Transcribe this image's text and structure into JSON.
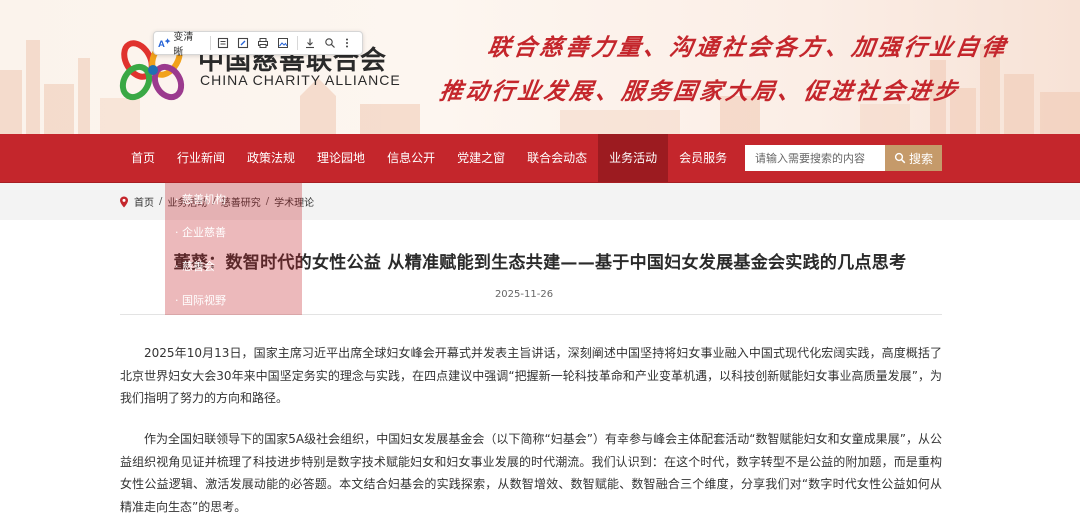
{
  "brand": {
    "name_cn": "中国慈善联合会",
    "name_en": "CHINA CHARITY ALLIANCE"
  },
  "slogan": {
    "line1": "联合慈善力量、沟通社会各方、加强行业自律",
    "line2": "推动行业发展、服务国家大局、促进社会进步"
  },
  "browser_toolbar": {
    "translate_label": "变清晰"
  },
  "nav": {
    "items": [
      {
        "label": "首页"
      },
      {
        "label": "行业新闻"
      },
      {
        "label": "政策法规"
      },
      {
        "label": "理论园地"
      },
      {
        "label": "信息公开"
      },
      {
        "label": "党建之窗"
      },
      {
        "label": "联合会动态"
      },
      {
        "label": "业务活动",
        "active": true
      },
      {
        "label": "会员服务"
      }
    ],
    "search_placeholder": "请输入需要搜索的内容",
    "search_button": "搜索"
  },
  "breadcrumb": [
    "首页",
    "业务活动",
    "慈善研究",
    "学术理论"
  ],
  "dropdown": {
    "items": [
      "慈善机构",
      "企业慈善",
      "慈善会",
      "国际视野"
    ]
  },
  "article": {
    "title": "董葵：数智时代的女性公益 从精准赋能到生态共建——基于中国妇女发展基金会实践的几点思考",
    "date": "2025-11-26",
    "paragraphs": [
      "2025年10月13日，国家主席习近平出席全球妇女峰会开幕式并发表主旨讲话，深刻阐述中国坚持将妇女事业融入中国式现代化宏阔实践，高度概括了北京世界妇女大会30年来中国坚定务实的理念与实践，在四点建议中强调“把握新一轮科技革命和产业变革机遇，以科技创新赋能妇女事业高质量发展”，为我们指明了努力的方向和路径。",
      "作为全国妇联领导下的国家5A级社会组织，中国妇女发展基金会（以下简称“妇基会”）有幸参与峰会主体配套活动“数智赋能妇女和女童成果展”，从公益组织视角见证并梳理了科技进步特别是数字技术赋能妇女和妇女事业发展的时代潮流。我们认识到：在这个时代，数字转型不是公益的附加题，而是重构女性公益逻辑、激活发展动能的必答题。本文结合妇基会的实践探索，从数智增效、数智赋能、数智融合三个维度，分享我们对“数字时代女性公益如何从精准走向生态”的思考。"
    ]
  },
  "colors": {
    "nav_red": "#c4262c",
    "nav_active": "#9c1b20",
    "search_gold": "#c59a6a",
    "slogan_red": "#c4262c"
  }
}
